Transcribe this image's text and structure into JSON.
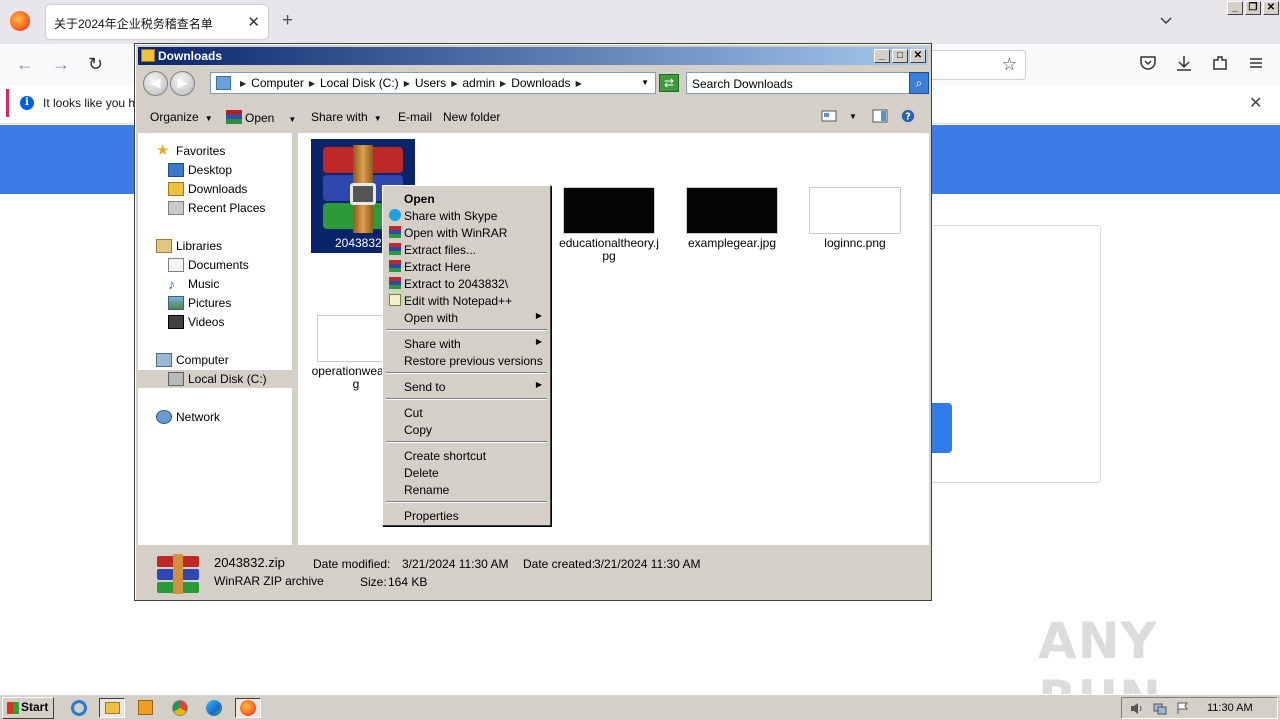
{
  "browser": {
    "tab_title": "关于2024年企业税务稽查名单",
    "tab_close": "✕",
    "new_tab": "+",
    "notification_text": "It looks like you ha",
    "notification_close": "✕"
  },
  "watermark": "ANY RUN",
  "explorer": {
    "title": "Downloads",
    "title_buttons": {
      "minimize": "_",
      "maximize": "□",
      "close": "✕"
    },
    "breadcrumbs": [
      "Computer",
      "Local Disk (C:)",
      "Users",
      "admin",
      "Downloads"
    ],
    "search_placeholder": "Search Downloads",
    "toolbar": {
      "organize": "Organize",
      "open": "Open",
      "share_with": "Share with",
      "email": "E-mail",
      "new_folder": "New folder"
    },
    "nav": {
      "favorites": "Favorites",
      "desktop": "Desktop",
      "downloads": "Downloads",
      "recent_places": "Recent Places",
      "libraries": "Libraries",
      "documents": "Documents",
      "music": "Music",
      "pictures": "Pictures",
      "videos": "Videos",
      "computer": "Computer",
      "local_disk": "Local Disk (C:)",
      "network": "Network"
    },
    "files": [
      {
        "name": "2043832.z",
        "type": "rar"
      },
      {
        "name": "educationaltheory.jpg",
        "type": "dark"
      },
      {
        "name": "examplegear.jpg",
        "type": "dark"
      },
      {
        "name": "loginnc.png",
        "type": "light"
      },
      {
        "name": "operationwea png",
        "type": "light"
      }
    ],
    "status": {
      "filename": "2043832.zip",
      "filetype": "WinRAR ZIP archive",
      "modified_label": "Date modified:",
      "modified_value": "3/21/2024 11:30 AM",
      "created_label": "Date created:",
      "created_value": "3/21/2024 11:30 AM",
      "size_label": "Size:",
      "size_value": "164 KB"
    }
  },
  "context_menu": {
    "open": "Open",
    "share_skype": "Share with Skype",
    "open_winrar": "Open with WinRAR",
    "extract_files": "Extract files...",
    "extract_here": "Extract Here",
    "extract_to": "Extract to 2043832\\",
    "edit_notepad": "Edit with Notepad++",
    "open_with": "Open with",
    "share_with": "Share with",
    "restore": "Restore previous versions",
    "send_to": "Send to",
    "cut": "Cut",
    "copy": "Copy",
    "create_shortcut": "Create shortcut",
    "delete": "Delete",
    "rename": "Rename",
    "properties": "Properties"
  },
  "taskbar": {
    "start": "Start",
    "clock": "11:30 AM"
  },
  "colors": {
    "title_bar_start": "#0a246a",
    "title_bar_end": "#a6caf0",
    "selection": "#0a246a",
    "page_banner": "#3d7be6"
  }
}
